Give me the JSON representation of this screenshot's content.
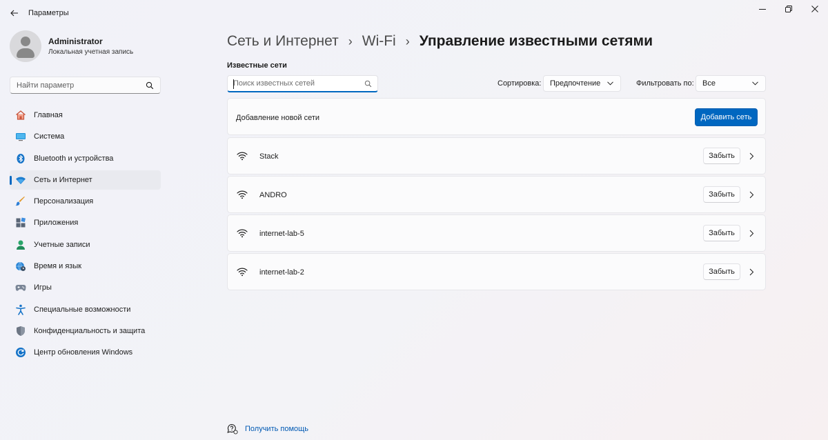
{
  "window": {
    "title": "Параметры"
  },
  "profile": {
    "name": "Administrator",
    "account_type": "Локальная учетная запись"
  },
  "sidebar": {
    "search_placeholder": "Найти параметр",
    "items": [
      {
        "label": "Главная",
        "icon": "home-icon",
        "active": false
      },
      {
        "label": "Система",
        "icon": "system-icon",
        "active": false
      },
      {
        "label": "Bluetooth и устройства",
        "icon": "bluetooth-icon",
        "active": false
      },
      {
        "label": "Сеть и Интернет",
        "icon": "wifi-icon",
        "active": true
      },
      {
        "label": "Персонализация",
        "icon": "brush-icon",
        "active": false
      },
      {
        "label": "Приложения",
        "icon": "apps-icon",
        "active": false
      },
      {
        "label": "Учетные записи",
        "icon": "accounts-icon",
        "active": false
      },
      {
        "label": "Время и язык",
        "icon": "globe-clock-icon",
        "active": false
      },
      {
        "label": "Игры",
        "icon": "gamepad-icon",
        "active": false
      },
      {
        "label": "Специальные возможности",
        "icon": "accessibility-icon",
        "active": false
      },
      {
        "label": "Конфиденциальность и защита",
        "icon": "shield-icon",
        "active": false
      },
      {
        "label": "Центр обновления Windows",
        "icon": "update-icon",
        "active": false
      }
    ]
  },
  "breadcrumb": {
    "items": [
      "Сеть и Интернет",
      "Wi-Fi"
    ],
    "current": "Управление известными сетями"
  },
  "known_networks": {
    "section_label": "Известные сети",
    "search_placeholder": "Поиск известных сетей",
    "sort_label": "Сортировка:",
    "sort_value": "Предпочтение",
    "filter_label": "Фильтровать по:",
    "filter_value": "Все",
    "add_label": "Добавление новой сети",
    "add_button": "Добавить сеть",
    "forget_button": "Забыть",
    "networks": [
      {
        "name": "Stack"
      },
      {
        "name": "ANDRO"
      },
      {
        "name": "internet-lab-5"
      },
      {
        "name": "internet-lab-2"
      }
    ]
  },
  "help": {
    "label": "Получить помощь"
  },
  "colors": {
    "accent": "#0067c0",
    "link": "#0059b3"
  }
}
